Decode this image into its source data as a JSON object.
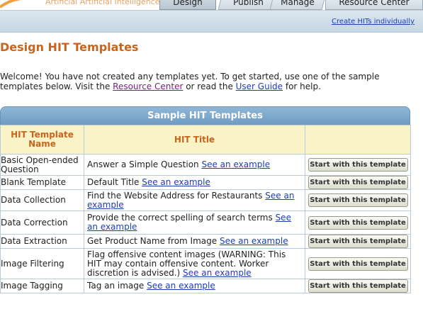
{
  "header": {
    "tagline": "Artificial Artificial Intelligence",
    "tabs": [
      {
        "label": "Design",
        "active": true
      },
      {
        "label": "Publish",
        "active": false
      },
      {
        "label": "Manage",
        "active": false
      },
      {
        "label": "Resource Center",
        "active": false
      }
    ],
    "colors": {
      "tab_active": "#b9c6d2",
      "tagline": "#e6a468"
    }
  },
  "subnav": {
    "create_link": "Create HITs individually"
  },
  "page": {
    "title": "Design HIT Templates",
    "intro": {
      "part1": "Welcome! You have not created any templates yet. To get started, use one of the sample templates below. Visit the ",
      "resource_link": "Resource Center",
      "part2": " or read the ",
      "guide_link": "User Guide",
      "part3": " for help."
    }
  },
  "templates_table": {
    "caption": "Sample HIT Templates",
    "columns": [
      "HIT Template Name",
      "HIT Title",
      ""
    ],
    "see_example_label": "See an example",
    "start_button_label": "Start with this template",
    "rows": [
      {
        "name": "Basic Open-ended Question",
        "title": "Answer a Simple Question"
      },
      {
        "name": "Blank Template",
        "title": "Default Title"
      },
      {
        "name": "Data Collection",
        "title": "Find the Website Address for Restaurants"
      },
      {
        "name": "Data Correction",
        "title": "Provide the correct spelling of search terms"
      },
      {
        "name": "Data Extraction",
        "title": "Get Product Name from Image"
      },
      {
        "name": "Image Filtering",
        "title": "Flag offensive content images (WARNING: This HIT may contain offensive content. Worker discretion is advised.)"
      },
      {
        "name": "Image Tagging",
        "title": "Tag an image"
      }
    ],
    "colors": {
      "header_bg": "#6f9cc4",
      "colhead_bg": "#fbf3c8",
      "colhead_text": "#c8641e",
      "link": "#1a3fb0"
    }
  }
}
